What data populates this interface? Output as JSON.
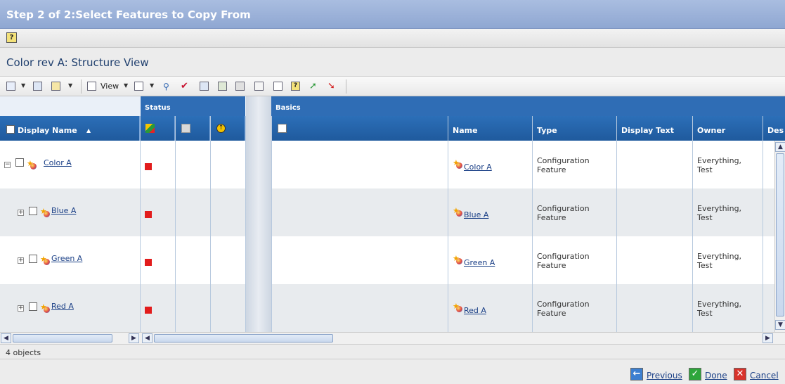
{
  "window": {
    "title": "Step 2 of 2:Select Features to Copy From"
  },
  "view": {
    "title": "Color rev A: Structure View"
  },
  "toolbar": {
    "view_label": "View"
  },
  "grid": {
    "group_headers": {
      "status": "Status",
      "basics": "Basics"
    },
    "columns": {
      "display_name": "Display Name",
      "sort_indicator": "▲",
      "name": "Name",
      "type": "Type",
      "display_text": "Display Text",
      "owner": "Owner",
      "description": "Des"
    },
    "rows": [
      {
        "display_name": "Color A",
        "name": "Color A",
        "type_line1": "Configuration",
        "type_line2": "Feature",
        "owner_line1": "Everything,",
        "owner_line2": "Test"
      },
      {
        "display_name": "Blue A",
        "name": "Blue A",
        "type_line1": "Configuration",
        "type_line2": "Feature",
        "owner_line1": "Everything,",
        "owner_line2": "Test"
      },
      {
        "display_name": "Green A",
        "name": "Green A",
        "type_line1": "Configuration",
        "type_line2": "Feature",
        "owner_line1": "Everything,",
        "owner_line2": "Test"
      },
      {
        "display_name": "Red A",
        "name": "Red A",
        "type_line1": "Configuration",
        "type_line2": "Feature",
        "owner_line1": "Everything,",
        "owner_line2": "Test"
      }
    ]
  },
  "status": {
    "count": "4 objects"
  },
  "footer": {
    "previous": "Previous",
    "done": "Done",
    "cancel": "Cancel"
  },
  "colors": {
    "title_bar": "#8fa7d2",
    "header_blue": "#2c6fb8",
    "status_red": "#e21c1c",
    "link": "#1a3f86"
  }
}
